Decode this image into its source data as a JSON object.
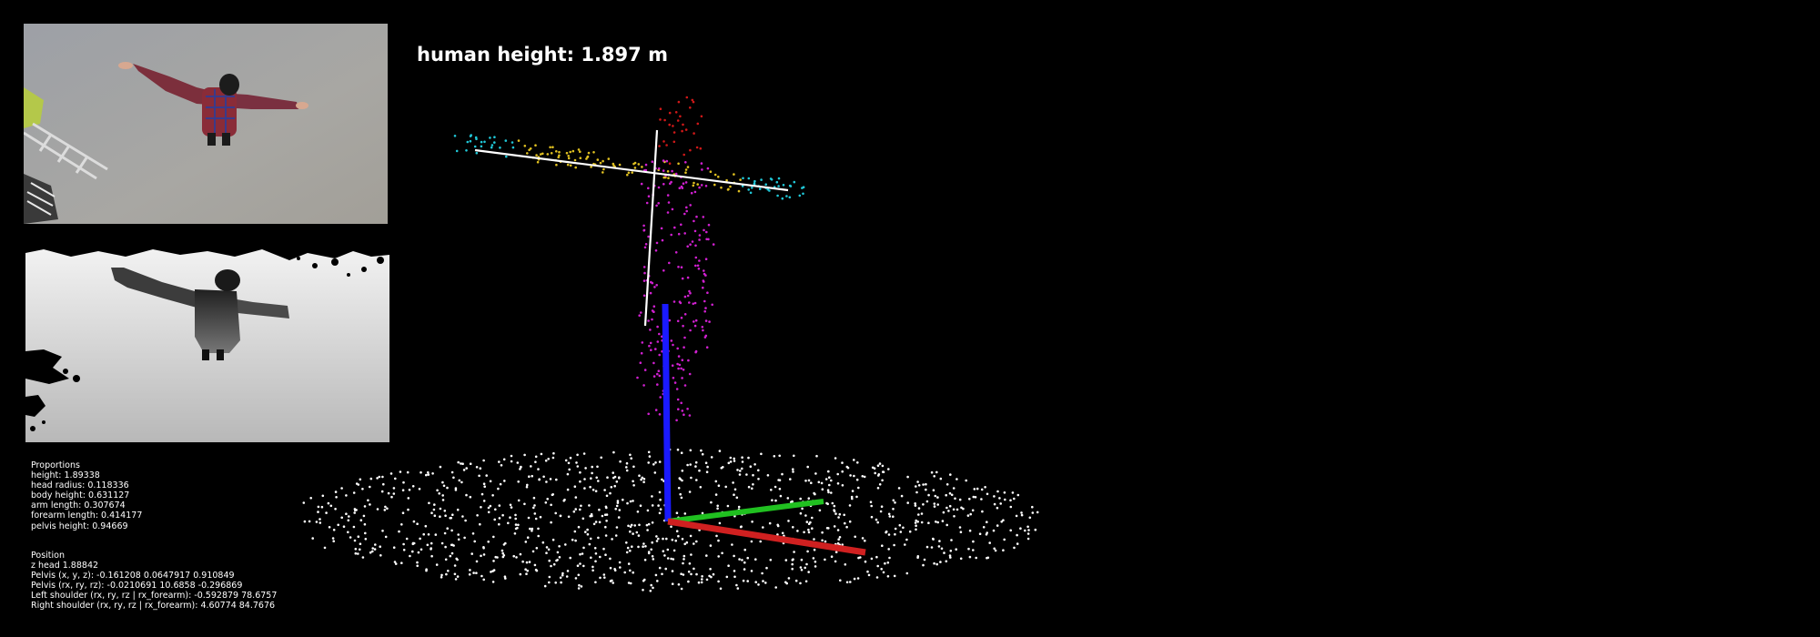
{
  "height_readout": "human height: 1.897 m",
  "proportions": {
    "title": "Proportions",
    "lines": [
      "height: 1.89338",
      "head radius: 0.118336",
      "body height: 0.631127",
      "arm length: 0.307674",
      "forearm length: 0.414177",
      "pelvis height: 0.94669"
    ]
  },
  "position": {
    "title": "Position",
    "lines": [
      "z head  1.88842",
      "Pelvis (x, y, z): -0.161208 0.0647917 0.910849",
      "Pelvis (rx, ry, rz): -0.0210691 10.6858 -0.296869",
      "Left shoulder (rx, ry, rz  |  rx_forearm): -0.592879 78.6757",
      "Right shoulder (rx, ry, rz  |  rx_forearm): 4.60774 84.7676"
    ]
  },
  "colors": {
    "background": "#000000",
    "axis_x": "#d02020",
    "axis_y": "#20c020",
    "axis_z": "#1a1aff",
    "skeleton": "#ffffff",
    "floor_points": "#ffffff",
    "arm_points_outer": "#20c8d8",
    "arm_points_inner": "#e0c020",
    "head_points": "#d01818",
    "body_points": "#d020d0"
  }
}
